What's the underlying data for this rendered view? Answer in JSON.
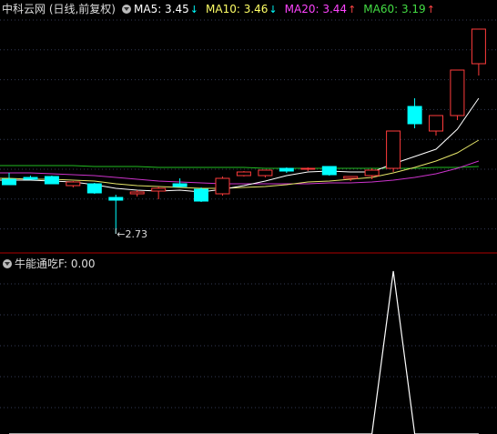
{
  "main": {
    "title": "中科云网 (日线,前复权)",
    "ma": [
      {
        "label": "MA5:",
        "value": "3.45",
        "arrow": "↓",
        "color": "#ffffff",
        "arrow_color": "#00ffff"
      },
      {
        "label": "MA10:",
        "value": "3.46",
        "arrow": "↓",
        "color": "#ffff66",
        "arrow_color": "#00ffff"
      },
      {
        "label": "MA20:",
        "value": "3.44",
        "arrow": "↑",
        "color": "#ff44ff",
        "arrow_color": "#ff4444"
      },
      {
        "label": "MA60:",
        "value": "3.19",
        "arrow": "↑",
        "color": "#44dd44",
        "arrow_color": "#ff4444"
      }
    ],
    "low_marker": "2.73"
  },
  "sub": {
    "indicator_label": "牛能通吃F",
    "indicator_value": ": 0.00"
  },
  "colors": {
    "up": "#ff3b3b",
    "down": "#00ffff",
    "grid": "#333a55",
    "separator": "#b00000"
  },
  "chart_data": {
    "type": "candlestick",
    "candles": [
      {
        "o": 3.33,
        "h": 3.4,
        "l": 3.27,
        "c": 3.27
      },
      {
        "o": 3.35,
        "h": 3.37,
        "l": 3.33,
        "c": 3.33
      },
      {
        "o": 3.36,
        "h": 3.37,
        "l": 3.28,
        "c": 3.28
      },
      {
        "o": 3.26,
        "h": 3.31,
        "l": 3.24,
        "c": 3.3
      },
      {
        "o": 3.28,
        "h": 3.29,
        "l": 3.17,
        "c": 3.18
      },
      {
        "o": 3.13,
        "h": 3.16,
        "l": 2.73,
        "c": 3.1
      },
      {
        "o": 3.17,
        "h": 3.21,
        "l": 3.14,
        "c": 3.19
      },
      {
        "o": 3.2,
        "h": 3.25,
        "l": 3.11,
        "c": 3.23
      },
      {
        "o": 3.28,
        "h": 3.34,
        "l": 3.25,
        "c": 3.25
      },
      {
        "o": 3.22,
        "h": 3.24,
        "l": 3.08,
        "c": 3.09
      },
      {
        "o": 3.17,
        "h": 3.36,
        "l": 3.15,
        "c": 3.34
      },
      {
        "o": 3.37,
        "h": 3.42,
        "l": 3.36,
        "c": 3.41
      },
      {
        "o": 3.37,
        "h": 3.43,
        "l": 3.35,
        "c": 3.43
      },
      {
        "o": 3.45,
        "h": 3.46,
        "l": 3.4,
        "c": 3.42
      },
      {
        "o": 3.44,
        "h": 3.46,
        "l": 3.42,
        "c": 3.45
      },
      {
        "o": 3.47,
        "h": 3.47,
        "l": 3.37,
        "c": 3.38
      },
      {
        "o": 3.34,
        "h": 3.36,
        "l": 3.31,
        "c": 3.36
      },
      {
        "o": 3.37,
        "h": 3.45,
        "l": 3.33,
        "c": 3.43
      },
      {
        "o": 3.45,
        "h": 3.86,
        "l": 3.41,
        "c": 3.86
      },
      {
        "o": 4.13,
        "h": 4.22,
        "l": 3.89,
        "c": 3.94
      },
      {
        "o": 3.86,
        "h": 4.03,
        "l": 3.81,
        "c": 4.03
      },
      {
        "o": 4.03,
        "h": 4.53,
        "l": 3.98,
        "c": 4.53
      },
      {
        "o": 4.6,
        "h": 4.98,
        "l": 4.47,
        "c": 4.98
      }
    ],
    "ma5": [
      3.32,
      3.32,
      3.31,
      3.3,
      3.27,
      3.23,
      3.21,
      3.2,
      3.21,
      3.19,
      3.22,
      3.26,
      3.31,
      3.37,
      3.41,
      3.42,
      3.41,
      3.41,
      3.5,
      3.58,
      3.66,
      3.88,
      4.22
    ],
    "ma10": [
      3.34,
      3.33,
      3.33,
      3.32,
      3.31,
      3.28,
      3.26,
      3.25,
      3.24,
      3.23,
      3.23,
      3.24,
      3.25,
      3.27,
      3.3,
      3.31,
      3.33,
      3.35,
      3.4,
      3.46,
      3.53,
      3.62,
      3.76
    ],
    "ma20": [
      3.4,
      3.4,
      3.39,
      3.38,
      3.37,
      3.35,
      3.33,
      3.31,
      3.3,
      3.29,
      3.28,
      3.28,
      3.28,
      3.28,
      3.28,
      3.29,
      3.29,
      3.3,
      3.32,
      3.35,
      3.39,
      3.45,
      3.53
    ],
    "ma60": [
      3.48,
      3.48,
      3.48,
      3.48,
      3.47,
      3.47,
      3.47,
      3.46,
      3.46,
      3.46,
      3.46,
      3.46,
      3.45,
      3.45,
      3.45,
      3.45,
      3.45,
      3.45,
      3.45,
      3.45,
      3.46,
      3.46,
      3.47
    ],
    "price_range": [
      2.6,
      5.1
    ],
    "indicator": [
      0,
      0,
      0,
      0,
      0,
      0,
      0,
      0,
      0,
      0,
      0,
      0,
      0,
      0,
      0,
      0,
      0,
      0,
      1,
      0,
      0,
      0,
      0
    ],
    "indicator_range": [
      0,
      1
    ]
  }
}
